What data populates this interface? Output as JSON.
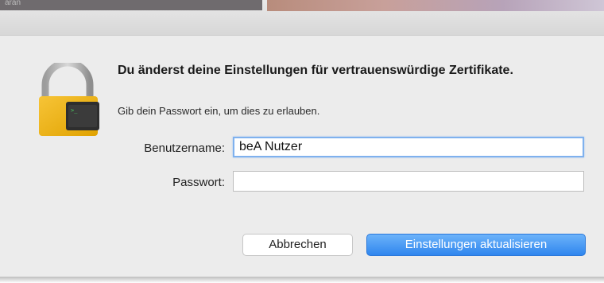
{
  "backdrop": {
    "window_text": "aran"
  },
  "dialog": {
    "icon": "lock-icon",
    "title": "Du änderst deine Einstellungen für vertrauenswürdige Zertifikate.",
    "subtitle": "Gib dein Passwort ein, um dies zu erlauben.",
    "username_label": "Benutzername:",
    "username_value": "beA Nutzer",
    "password_label": "Passwort:",
    "password_value": "",
    "cancel_label": "Abbrechen",
    "ok_label": "Einstellungen aktualisieren"
  },
  "colors": {
    "accent": "#2f86ee",
    "dialog_bg": "#ececec",
    "lock_gold": "#f0b400"
  }
}
